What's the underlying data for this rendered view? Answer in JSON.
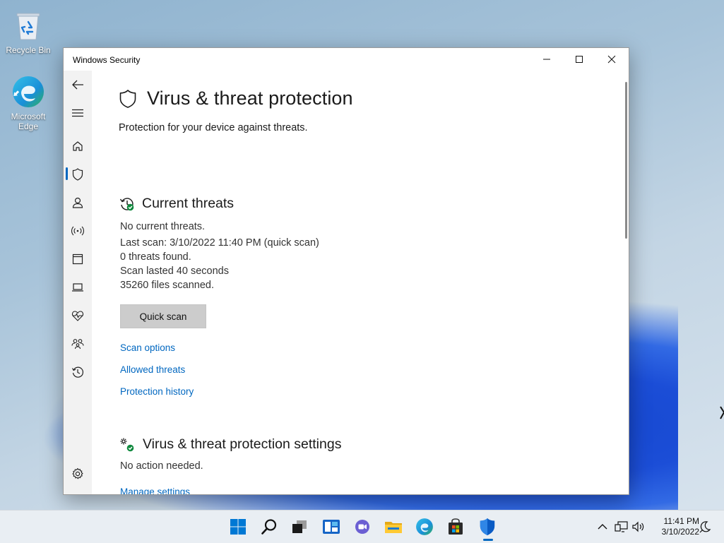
{
  "desktop": {
    "icons": [
      {
        "label": "Recycle Bin",
        "icon": "recycle-bin-icon"
      },
      {
        "label": "Microsoft Edge",
        "icon": "edge-icon"
      }
    ]
  },
  "window": {
    "title": "Windows Security",
    "controls": [
      "minimize",
      "maximize",
      "close"
    ]
  },
  "nav": {
    "items": [
      {
        "name": "back",
        "icon": "back-arrow-icon"
      },
      {
        "name": "menu",
        "icon": "hamburger-icon"
      },
      {
        "name": "home",
        "icon": "home-icon"
      },
      {
        "name": "virus-threat-protection",
        "icon": "shield-icon",
        "active": true
      },
      {
        "name": "account-protection",
        "icon": "person-icon"
      },
      {
        "name": "firewall-network",
        "icon": "wireless-icon"
      },
      {
        "name": "app-browser-control",
        "icon": "app-window-icon"
      },
      {
        "name": "device-security",
        "icon": "laptop-icon"
      },
      {
        "name": "device-performance-health",
        "icon": "heart-pulse-icon"
      },
      {
        "name": "family-options",
        "icon": "family-icon"
      },
      {
        "name": "protection-history",
        "icon": "history-icon"
      },
      {
        "name": "settings",
        "icon": "gear-icon"
      }
    ]
  },
  "page": {
    "title": "Virus & threat protection",
    "subtitle": "Protection for your device against threats.",
    "current_threats": {
      "heading": "Current threats",
      "no_threats": "No current threats.",
      "last_scan": "Last scan: 3/10/2022 11:40 PM (quick scan)",
      "threats_found": "0 threats found.",
      "scan_duration": "Scan lasted 40 seconds",
      "files_scanned": "35260 files scanned.",
      "quick_scan_button": "Quick scan",
      "links": {
        "scan_options": "Scan options",
        "allowed_threats": "Allowed threats",
        "protection_history": "Protection history"
      }
    },
    "settings_section": {
      "heading": "Virus & threat protection settings",
      "status": "No action needed.",
      "manage_link": "Manage settings"
    }
  },
  "taskbar": {
    "apps": [
      "start",
      "search",
      "task-view",
      "widgets",
      "teams-chat",
      "file-explorer",
      "edge",
      "microsoft-store",
      "windows-security"
    ],
    "active_app": "windows-security",
    "clock": {
      "time": "11:41 PM",
      "date": "3/10/2022"
    }
  },
  "colors": {
    "accent": "#0067c0",
    "nav_background": "#f2f2f2",
    "status_green": "#10893e"
  }
}
